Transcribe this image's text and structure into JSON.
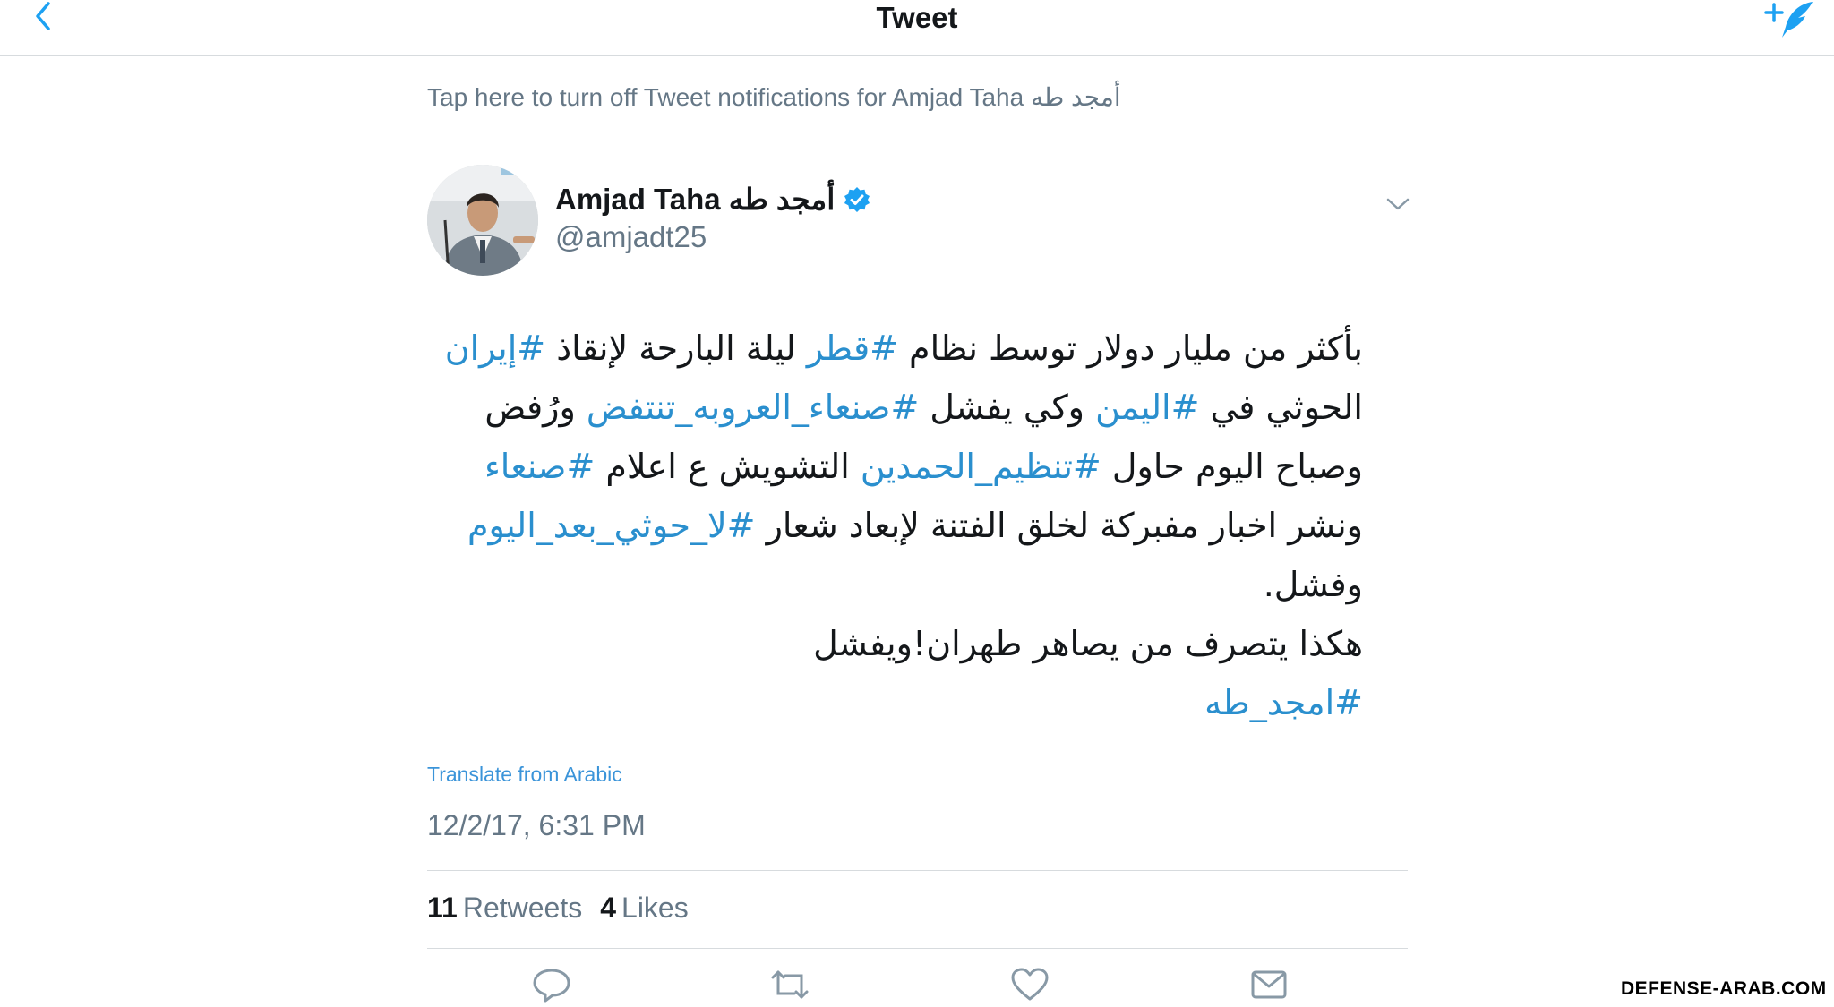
{
  "header": {
    "title": "Tweet"
  },
  "notification_banner": "Tap here to turn off Tweet notifications for Amjad Taha أمجد طه",
  "author": {
    "name": "Amjad Taha أمجد طه",
    "handle": "@amjadt25",
    "verified": true
  },
  "tweet": {
    "lines": [
      [
        {
          "t": "بأكثر من مليار دولار توسط نظام ",
          "tag": false
        },
        {
          "t": "#قطر",
          "tag": true
        },
        {
          "t": " ليلة البارحة لإنقاذ ",
          "tag": false
        },
        {
          "t": "#إيران",
          "tag": true
        }
      ],
      [
        {
          "t": "الحوثي في ",
          "tag": false
        },
        {
          "t": "#اليمن",
          "tag": true
        },
        {
          "t": " وكي يفشل ",
          "tag": false
        },
        {
          "t": "#صنعاء_العروبه_تنتفض",
          "tag": true
        },
        {
          "t": " ورُفض",
          "tag": false
        }
      ],
      [
        {
          "t": "وصباح اليوم حاول ",
          "tag": false
        },
        {
          "t": "#تنظيم_الحمدين",
          "tag": true
        },
        {
          "t": " التشويش ع اعلام ",
          "tag": false
        },
        {
          "t": "#صنعاء",
          "tag": true
        }
      ],
      [
        {
          "t": "ونشر اخبار مفبركة لخلق الفتنة لإبعاد شعار ",
          "tag": false
        },
        {
          "t": "#لا_حوثي_بعد_اليوم",
          "tag": true
        }
      ],
      [
        {
          "t": "وفشل.",
          "tag": false
        }
      ],
      [
        {
          "t": "هكذا يتصرف من يصاهر طهران!ويفشل",
          "tag": false
        }
      ],
      [
        {
          "t": "#امجد_طه",
          "tag": true
        }
      ]
    ],
    "translate_label": "Translate from Arabic",
    "timestamp": "12/2/17, 6:31 PM"
  },
  "stats": {
    "retweets_count": "11",
    "retweets_label": "Retweets",
    "likes_count": "4",
    "likes_label": "Likes"
  },
  "watermark": "DEFENSE-ARAB.COM",
  "colors": {
    "link": "#2a8fce",
    "accent": "#1da1f2",
    "muted": "#657786"
  },
  "icons": {
    "back": "chevron-left-icon",
    "compose": "compose-quill-icon",
    "caret": "chevron-down-icon",
    "reply": "reply-icon",
    "retweet": "retweet-icon",
    "like": "heart-icon",
    "dm": "envelope-icon"
  }
}
